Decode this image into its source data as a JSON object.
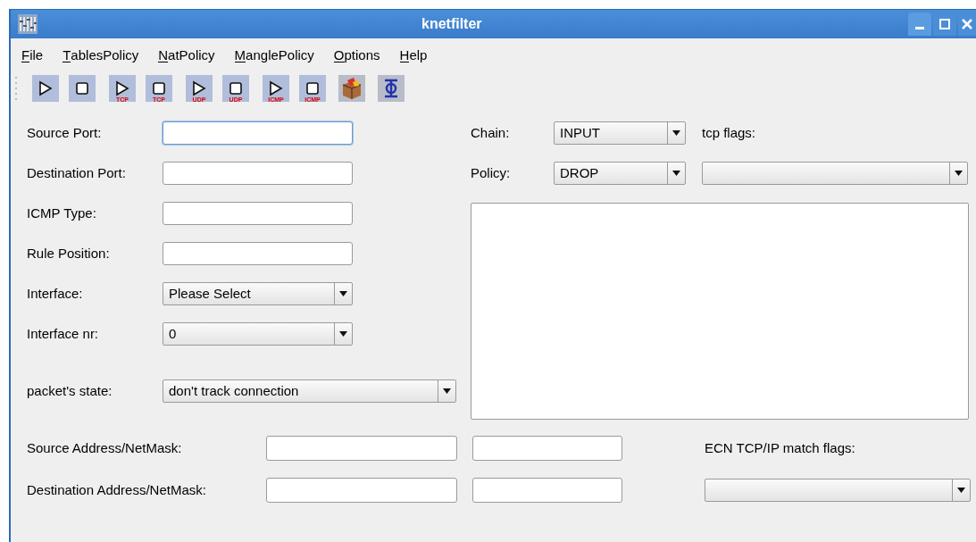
{
  "window": {
    "title": "knetfilter"
  },
  "menu": [
    {
      "label": "File"
    },
    {
      "label": "TablesPolicy"
    },
    {
      "label": "NatPolicy"
    },
    {
      "label": "ManglePolicy"
    },
    {
      "label": "Options"
    },
    {
      "label": "Help"
    }
  ],
  "toolbar": [
    {
      "kind": "start"
    },
    {
      "kind": "stop"
    },
    {
      "kind": "start",
      "badge": "TCP"
    },
    {
      "kind": "stop",
      "badge": "TCP"
    },
    {
      "kind": "start",
      "badge": "UDP"
    },
    {
      "kind": "stop",
      "badge": "UDP"
    },
    {
      "kind": "start",
      "badge": "ICMP"
    },
    {
      "kind": "stop",
      "badge": "ICMP"
    },
    {
      "kind": "package"
    },
    {
      "kind": "network"
    }
  ],
  "fields": [
    {
      "kind": "text",
      "label": "Source Port:",
      "focused": true
    },
    {
      "kind": "text",
      "label": "Destination Port:",
      "focused": false
    },
    {
      "kind": "text",
      "label": "ICMP Type:",
      "focused": false
    },
    {
      "kind": "text",
      "label": "Rule Position:",
      "focused": false
    },
    {
      "kind": "select",
      "label": "Interface:",
      "value": "Please Select"
    },
    {
      "kind": "select",
      "label": "Interface nr:",
      "value": "0"
    },
    {
      "kind": "wide_select",
      "label": "packet's state:",
      "value": "don't track connection"
    }
  ],
  "chain": {
    "label": "Chain:",
    "value": "INPUT"
  },
  "policy": {
    "label": "Policy:",
    "value": "DROP"
  },
  "tcp_flags": {
    "label": "tcp flags:"
  },
  "addresses": [
    {
      "label": "Source Address/NetMask:"
    },
    {
      "label": "Destination Address/NetMask:"
    }
  ],
  "ecn": {
    "label": "ECN TCP/IP match flags:"
  }
}
